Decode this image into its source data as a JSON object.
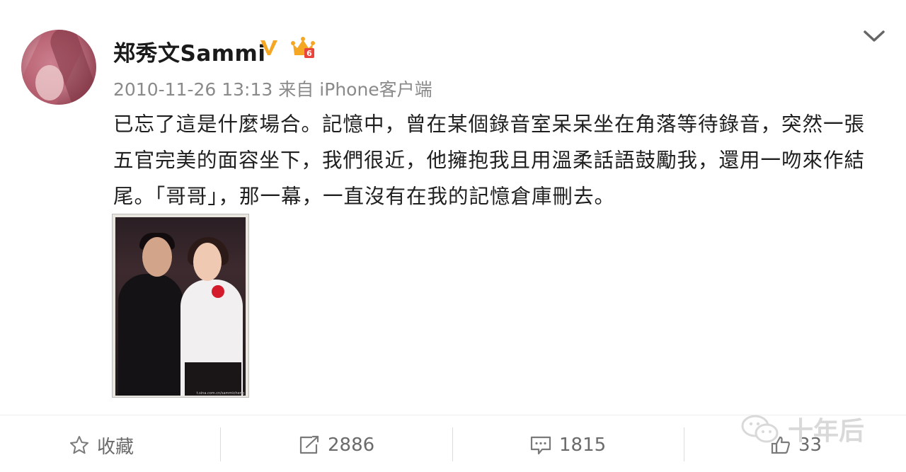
{
  "post": {
    "author": "郑秀文Sammi",
    "timestamp": "2010-11-26 13:13",
    "source_prefix": "来自",
    "source": "iPhone客户端",
    "text": "已忘了這是什麼場合。記憶中，曾在某個錄音室呆呆坐在角落等待錄音，突然一張五官完美的面容坐下，我們很近，他擁抱我且用溫柔話語鼓勵我，還用一吻來作結尾。「哥哥」，那一幕，一直沒有在我的記憶倉庫刪去。",
    "photo_caption": "t.sina.com.cn/sammicheng"
  },
  "icons": {
    "verified": "verified-v-icon",
    "member": "crown-icon",
    "menu": "chevron-down-icon",
    "favorite": "star-icon",
    "repost": "repost-icon",
    "comment": "comment-icon",
    "like": "thumbs-up-icon"
  },
  "actions": {
    "favorite_label": "收藏",
    "repost_count": "2886",
    "comment_count": "1815",
    "like_count": "33"
  },
  "watermark": {
    "text": "十年后"
  },
  "colors": {
    "verified": "#f5a623",
    "crown": "#f5a623",
    "meta_text": "#8a8a8a",
    "action_text": "#6b6b6b"
  }
}
